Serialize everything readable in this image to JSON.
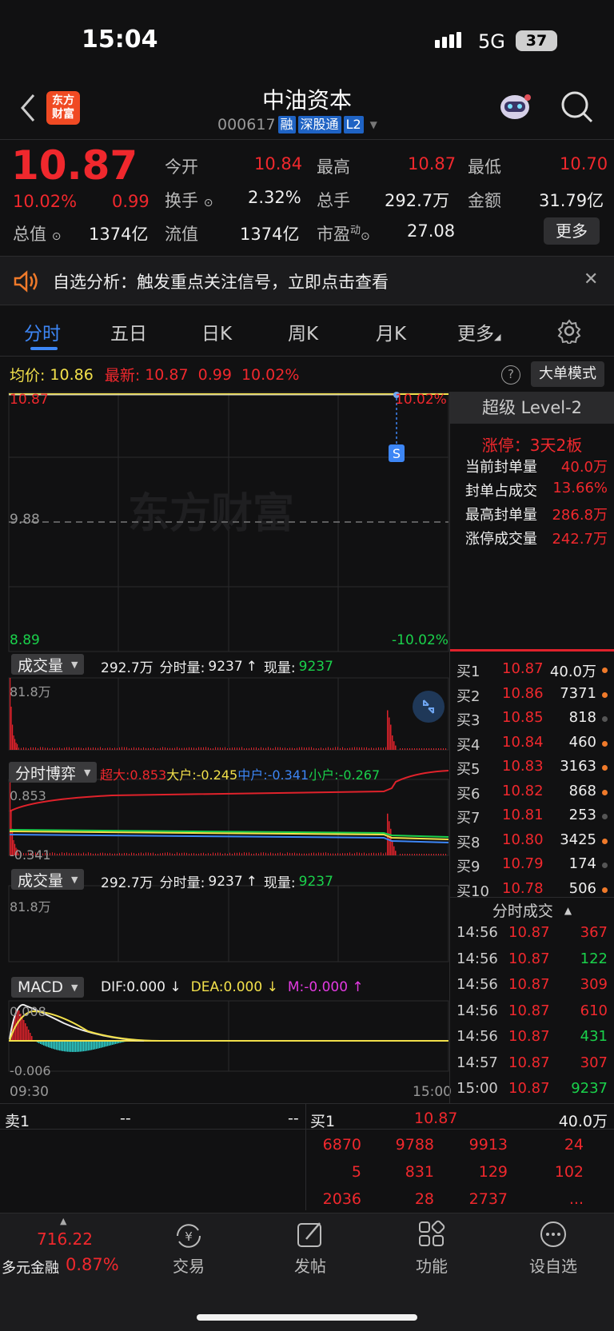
{
  "status": {
    "time": "15:04",
    "network": "5G",
    "battery": "37"
  },
  "header": {
    "logo_text": "东方\n财富",
    "title": "中油资本",
    "code": "000617",
    "tags": [
      "融",
      "深股通",
      "L2"
    ]
  },
  "quote": {
    "price": "10.87",
    "change_pct": "10.02%",
    "change": "0.99",
    "open_label": "今开",
    "open": "10.84",
    "high_label": "最高",
    "high": "10.87",
    "low_label": "最低",
    "low": "10.70",
    "turnover_label": "换手",
    "turnover": "2.32%",
    "volume_label": "总手",
    "volume": "292.7万",
    "amount_label": "金额",
    "amount": "31.79亿",
    "mcap_label": "总值",
    "mcap": "1374亿",
    "float_label": "流值",
    "float": "1374亿",
    "pe_label": "市盈",
    "pe_super": "动",
    "pe": "27.08",
    "more": "更多"
  },
  "banner": {
    "text": "自选分析：触发重点关注信号，立即点击查看"
  },
  "tabs": [
    "分时",
    "五日",
    "日K",
    "周K",
    "月K",
    "更多"
  ],
  "avg_bar": {
    "avg_label": "均价:",
    "avg": "10.86",
    "latest_label": "最新:",
    "latest": "10.87",
    "chg": "0.99",
    "pct": "10.02%",
    "mode": "大单模式"
  },
  "chart": {
    "y_top": "10.87",
    "y_mid": "9.88",
    "y_bot": "8.89",
    "pct_top": "10.02%",
    "pct_bot": "-10.02%",
    "marker": "S",
    "x_start": "09:30",
    "x_end": "15:00",
    "watermark": "东方财富"
  },
  "vol1": {
    "label": "成交量",
    "total": "292.7万",
    "fen_label": "分时量:",
    "fen": "9237",
    "arrow": "↑",
    "now_label": "现量:",
    "now": "9237",
    "max": "81.8万"
  },
  "bop": {
    "label": "分时博弈",
    "super": "超大:0.853",
    "big": "大户:-0.245",
    "mid": "中户:-0.341",
    "small": "小户:-0.267",
    "y_top": "0.853",
    "y_bot": "-0.341"
  },
  "vol2": {
    "label": "成交量",
    "total": "292.7万",
    "fen_label": "分时量:",
    "fen": "9237",
    "arrow": "↑",
    "now_label": "现量:",
    "now": "9237",
    "max": "81.8万"
  },
  "macd": {
    "label": "MACD",
    "dif": "DIF:0.000 ↓",
    "dea": "DEA:0.000 ↓",
    "m": "M:-0.000 ↑",
    "y_top": "0.008",
    "y_bot": "-0.006"
  },
  "level2": {
    "title": "超级 Level-2",
    "limit_up": "涨停：3天2板",
    "rows": [
      {
        "k": "当前封单量",
        "v": "40.0万"
      },
      {
        "k": "封单占成交",
        "v": "13.66%"
      },
      {
        "k": "最高封单量",
        "v": "286.8万"
      },
      {
        "k": "涨停成交量",
        "v": "242.7万"
      }
    ]
  },
  "bids": [
    {
      "l": "买1",
      "p": "10.87",
      "v": "40.0万"
    },
    {
      "l": "买2",
      "p": "10.86",
      "v": "7371"
    },
    {
      "l": "买3",
      "p": "10.85",
      "v": "818"
    },
    {
      "l": "买4",
      "p": "10.84",
      "v": "460"
    },
    {
      "l": "买5",
      "p": "10.83",
      "v": "3163"
    },
    {
      "l": "买6",
      "p": "10.82",
      "v": "868"
    },
    {
      "l": "买7",
      "p": "10.81",
      "v": "253"
    },
    {
      "l": "买8",
      "p": "10.80",
      "v": "3425"
    },
    {
      "l": "买9",
      "p": "10.79",
      "v": "174"
    },
    {
      "l": "买10",
      "p": "10.78",
      "v": "506"
    }
  ],
  "trades_title": "分时成交",
  "trades": [
    {
      "t": "14:56",
      "p": "10.87",
      "v": "367"
    },
    {
      "t": "14:56",
      "p": "10.87",
      "v": "122"
    },
    {
      "t": "14:56",
      "p": "10.87",
      "v": "309"
    },
    {
      "t": "14:56",
      "p": "10.87",
      "v": "610"
    },
    {
      "t": "14:56",
      "p": "10.87",
      "v": "431"
    },
    {
      "t": "14:57",
      "p": "10.87",
      "v": "307"
    },
    {
      "t": "15:00",
      "p": "10.87",
      "v": "9237"
    }
  ],
  "queue": {
    "sell_label": "卖1",
    "sell_p": "--",
    "sell_v": "--",
    "buy_label": "买1",
    "buy_p": "10.87",
    "buy_v": "40.0万",
    "rows": [
      [
        "6870",
        "9788",
        "9913",
        "24"
      ],
      [
        "5",
        "831",
        "129",
        "102"
      ],
      [
        "2036",
        "28",
        "2737",
        "..."
      ]
    ]
  },
  "bottom": {
    "index_val": "716.22",
    "index_name": "多元金融",
    "index_pct": "0.87%",
    "nav": [
      "交易",
      "发帖",
      "功能",
      "设自选"
    ]
  },
  "colors": {
    "up": "#f0282d",
    "down": "#1ad14b",
    "avg": "#f2e04b",
    "bg": "#111112"
  }
}
